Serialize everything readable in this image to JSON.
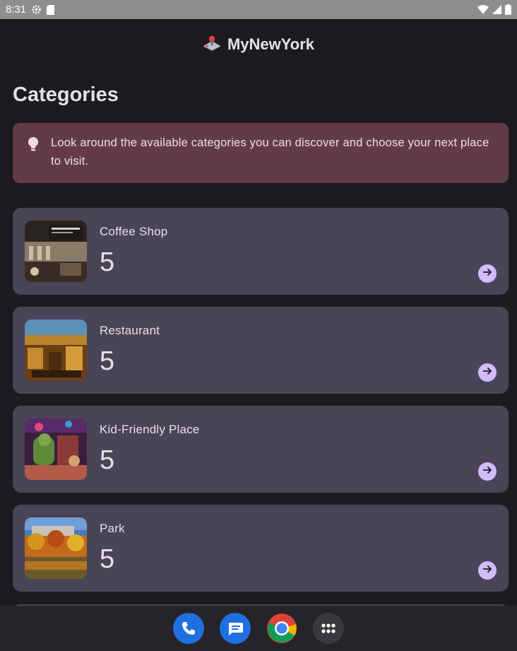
{
  "status_bar": {
    "time": "8:31"
  },
  "app_bar": {
    "title": "MyNewYork"
  },
  "page": {
    "title": "Categories"
  },
  "tip": {
    "text": "Look around the available categories you can discover and choose your next place to visit."
  },
  "categories": [
    {
      "name": "Coffee Shop",
      "count": "5"
    },
    {
      "name": "Restaurant",
      "count": "5"
    },
    {
      "name": "Kid-Friendly Place",
      "count": "5"
    },
    {
      "name": "Park",
      "count": "5"
    }
  ],
  "dock": {
    "apps": [
      "phone-icon",
      "messages-icon",
      "chrome-icon",
      "app-drawer-icon"
    ]
  },
  "colors": {
    "background": "#1c1b1f",
    "tip_card": "#633b48",
    "category_card": "#4a4458",
    "arrow_accent": "#d0bcff"
  }
}
